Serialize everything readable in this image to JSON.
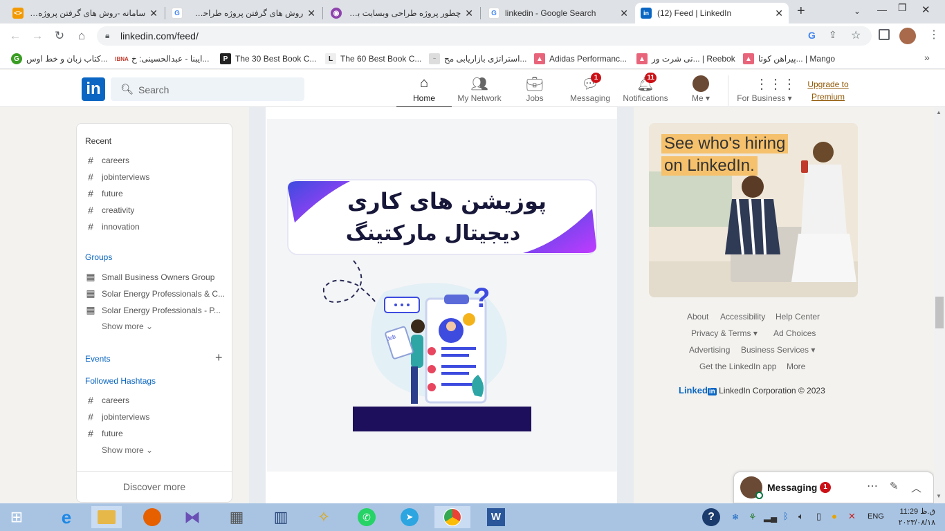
{
  "browser": {
    "tabs": [
      {
        "title": "سامانه -روش های گرفتن پروژه ط",
        "icon": "code-tag-icon"
      },
      {
        "title": "روش های گرفتن پروژه طراحی سا",
        "icon": "google-g-icon"
      },
      {
        "title": "چطور پروژه طراحی وبسایت بگیر",
        "icon": "podcast-icon"
      },
      {
        "title": "linkedin - Google Search",
        "icon": "google-g-icon"
      },
      {
        "title": "(12) Feed | LinkedIn",
        "icon": "linkedin-icon"
      }
    ],
    "url": "linkedin.com/feed/",
    "bookmarks": [
      {
        "label": "کتاب زبان و خط اوس...",
        "icon": "green-g-icon"
      },
      {
        "label": "ایبنا - عبدالحسینی: خ...",
        "icon": "ibna-icon"
      },
      {
        "label": "The 30 Best Book C...",
        "icon": "p-icon"
      },
      {
        "label": "The 60 Best Book C...",
        "icon": "l-icon"
      },
      {
        "label": "استراتژی بازاریابی مح...",
        "icon": "site-icon"
      },
      {
        "label": "Adidas Performanc...",
        "icon": "shoe-icon"
      },
      {
        "label": "تی شرت ور... | Reebok",
        "icon": "shoe-icon"
      },
      {
        "label": "پیراهن کوتا... | Mango",
        "icon": "shoe-icon"
      }
    ]
  },
  "linkedin": {
    "logo": "in",
    "search_placeholder": "Search",
    "nav": [
      {
        "label": "Home",
        "icon": "home-icon"
      },
      {
        "label": "My Network",
        "icon": "network-icon"
      },
      {
        "label": "Jobs",
        "icon": "briefcase-icon"
      },
      {
        "label": "Messaging",
        "icon": "messaging-icon",
        "badge": "1"
      },
      {
        "label": "Notifications",
        "icon": "bell-icon",
        "badge": "11"
      },
      {
        "label": "Me",
        "icon": "avatar"
      },
      {
        "label": "For Business",
        "icon": "grid-icon"
      }
    ],
    "upgrade": "Upgrade to Premium"
  },
  "sidebar": {
    "recent_title": "Recent",
    "recent": [
      "careers",
      "jobinterviews",
      "future",
      "creativity",
      "innovation"
    ],
    "groups_title": "Groups",
    "groups": [
      "Small Business Owners Group",
      "Solar Energy Professionals & C...",
      "Solar Energy Professionals - P..."
    ],
    "show_more": "Show more",
    "events_title": "Events",
    "hashtags_title": "Followed Hashtags",
    "hashtags": [
      "careers",
      "jobinterviews",
      "future"
    ],
    "discover": "Discover more"
  },
  "post": {
    "line1": "پوزیشن های کاری",
    "line2": "دیجیتال مارکتینگ",
    "doc_label": "Job"
  },
  "ad": {
    "line1": "See who's hiring",
    "line2": "on LinkedIn."
  },
  "footer": {
    "links": [
      "About",
      "Accessibility",
      "Help Center",
      "Privacy & Terms",
      "Ad Choices",
      "Advertising",
      "Business Services",
      "Get the LinkedIn app",
      "More"
    ],
    "brand": "Linked",
    "copyright": "LinkedIn Corporation © 2023"
  },
  "messaging": {
    "label": "Messaging",
    "badge": "1"
  },
  "taskbar": {
    "lang": "ENG",
    "time": "11:29 ق.ظ",
    "date": "۲۰۲۳/۰۸/۱۸"
  },
  "colors": {
    "linkedin_blue": "#0a66c2",
    "badge_red": "#cc1016",
    "premium_gold": "#915907",
    "banner_purple": "#7b2ff7",
    "ad_orange": "#f5c16c"
  }
}
